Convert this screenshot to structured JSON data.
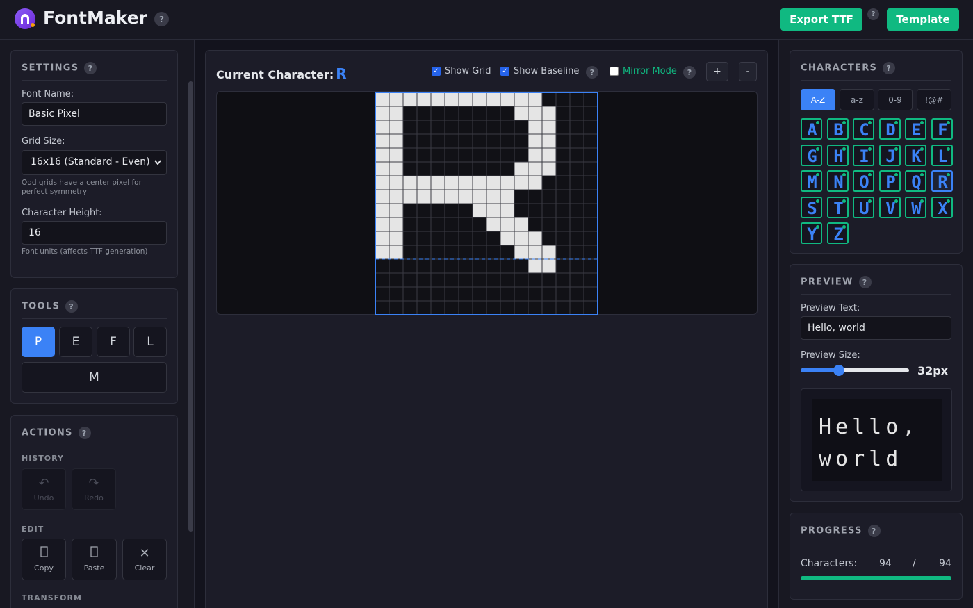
{
  "header": {
    "app_title": "FontMaker",
    "help": "?",
    "export_label": "Export TTF",
    "template_label": "Template"
  },
  "settings": {
    "title": "SETTINGS",
    "font_name_label": "Font Name:",
    "font_name_value": "Basic Pixel",
    "grid_size_label": "Grid Size:",
    "grid_size_value": "16x16 (Standard - Even)",
    "grid_hint": "Odd grids have a center pixel for perfect symmetry",
    "char_height_label": "Character Height:",
    "char_height_value": "16",
    "char_height_hint": "Font units (affects TTF generation)"
  },
  "tools": {
    "title": "TOOLS",
    "items": [
      "P",
      "E",
      "F",
      "L",
      "M"
    ],
    "active": "P"
  },
  "actions": {
    "title": "ACTIONS",
    "history_label": "HISTORY",
    "undo_label": "Undo",
    "redo_label": "Redo",
    "edit_label": "EDIT",
    "copy_label": "Copy",
    "paste_label": "Paste",
    "clear_label": "Clear",
    "transform_label": "TRANSFORM"
  },
  "editor": {
    "current_label": "Current Character:",
    "current_char": "R",
    "show_grid_label": "Show Grid",
    "show_grid": true,
    "show_baseline_label": "Show Baseline",
    "show_baseline": true,
    "mirror_label": "Mirror Mode",
    "mirror": false,
    "zoom_in": "+",
    "zoom_out": "-",
    "grid_cols": 16,
    "grid_rows": 16,
    "baseline_row": 12,
    "pixels": [
      [
        0,
        0
      ],
      [
        1,
        0
      ],
      [
        2,
        0
      ],
      [
        3,
        0
      ],
      [
        4,
        0
      ],
      [
        5,
        0
      ],
      [
        6,
        0
      ],
      [
        7,
        0
      ],
      [
        8,
        0
      ],
      [
        9,
        0
      ],
      [
        10,
        0
      ],
      [
        11,
        0
      ],
      [
        0,
        1
      ],
      [
        1,
        1
      ],
      [
        10,
        1
      ],
      [
        11,
        1
      ],
      [
        12,
        1
      ],
      [
        0,
        2
      ],
      [
        1,
        2
      ],
      [
        11,
        2
      ],
      [
        12,
        2
      ],
      [
        0,
        3
      ],
      [
        1,
        3
      ],
      [
        11,
        3
      ],
      [
        12,
        3
      ],
      [
        0,
        4
      ],
      [
        1,
        4
      ],
      [
        11,
        4
      ],
      [
        12,
        4
      ],
      [
        0,
        5
      ],
      [
        1,
        5
      ],
      [
        10,
        5
      ],
      [
        11,
        5
      ],
      [
        12,
        5
      ],
      [
        0,
        6
      ],
      [
        1,
        6
      ],
      [
        2,
        6
      ],
      [
        3,
        6
      ],
      [
        4,
        6
      ],
      [
        5,
        6
      ],
      [
        6,
        6
      ],
      [
        7,
        6
      ],
      [
        8,
        6
      ],
      [
        9,
        6
      ],
      [
        10,
        6
      ],
      [
        11,
        6
      ],
      [
        0,
        7
      ],
      [
        1,
        7
      ],
      [
        2,
        7
      ],
      [
        3,
        7
      ],
      [
        4,
        7
      ],
      [
        5,
        7
      ],
      [
        6,
        7
      ],
      [
        7,
        7
      ],
      [
        8,
        7
      ],
      [
        9,
        7
      ],
      [
        0,
        8
      ],
      [
        1,
        8
      ],
      [
        7,
        8
      ],
      [
        8,
        8
      ],
      [
        9,
        8
      ],
      [
        0,
        9
      ],
      [
        1,
        9
      ],
      [
        8,
        9
      ],
      [
        9,
        9
      ],
      [
        10,
        9
      ],
      [
        0,
        10
      ],
      [
        1,
        10
      ],
      [
        9,
        10
      ],
      [
        10,
        10
      ],
      [
        11,
        10
      ],
      [
        0,
        11
      ],
      [
        1,
        11
      ],
      [
        10,
        11
      ],
      [
        11,
        11
      ],
      [
        12,
        11
      ],
      [
        11,
        12
      ],
      [
        12,
        12
      ]
    ]
  },
  "characters": {
    "title": "CHARACTERS",
    "tabs": [
      "A-Z",
      "a-z",
      "0-9",
      "!@#"
    ],
    "active_tab": "A-Z",
    "letters": [
      "A",
      "B",
      "C",
      "D",
      "E",
      "F",
      "G",
      "H",
      "I",
      "J",
      "K",
      "L",
      "M",
      "N",
      "O",
      "P",
      "Q",
      "R",
      "S",
      "T",
      "U",
      "V",
      "W",
      "X",
      "Y",
      "Z"
    ],
    "selected": "R"
  },
  "preview": {
    "title": "PREVIEW",
    "text_label": "Preview Text:",
    "text_value": "Hello, world",
    "size_label": "Preview Size:",
    "size_value": "32px",
    "size_fraction": 0.35
  },
  "progress": {
    "title": "PROGRESS",
    "label": "Characters:",
    "done": "94",
    "sep": "/",
    "total": "94",
    "fraction": 1.0
  },
  "colors": {
    "accent": "#3b82f6",
    "success": "#10b981",
    "pixel": "#e5e5e5"
  }
}
